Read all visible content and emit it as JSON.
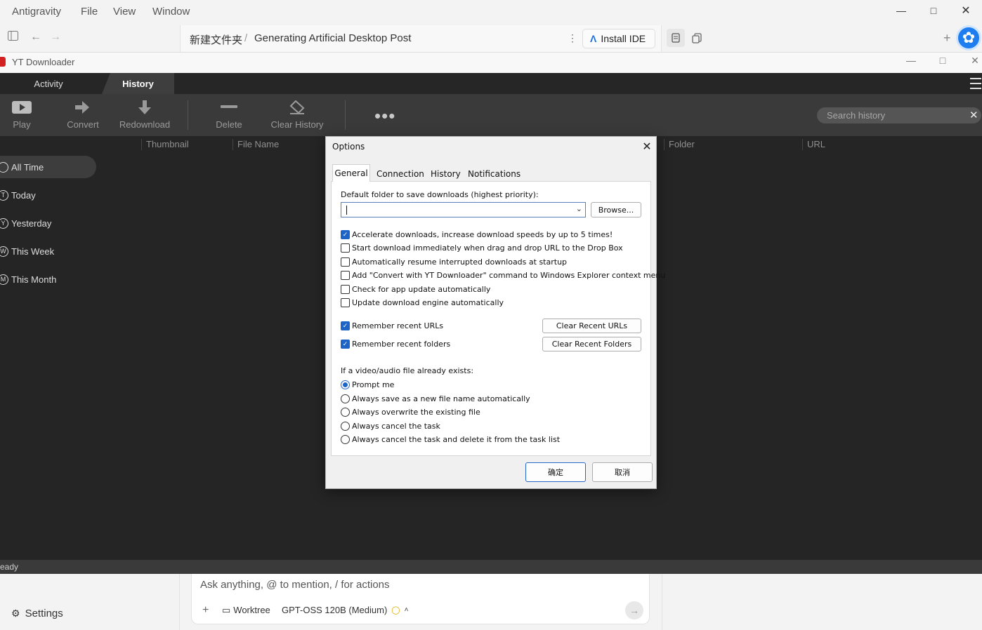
{
  "antigravity": {
    "menu": [
      "Antigravity",
      "File",
      "View",
      "Window"
    ],
    "breadcrumb": {
      "folder": "新建文件夹",
      "separator": "/",
      "page": "Generating Artificial Desktop Post"
    },
    "install_ide": "Install IDE",
    "chat": {
      "placeholder": "Ask anything, @ to mention, / for actions",
      "plus": "+",
      "worktree": "Worktree",
      "model": "GPT-OSS 120B (Medium)"
    },
    "settings": "Settings"
  },
  "yt": {
    "title": "YT Downloader",
    "tabs": [
      "Activity",
      "History"
    ],
    "active_tab": "History",
    "toolbar": [
      "Play",
      "Convert",
      "Redownload",
      "Delete",
      "Clear History"
    ],
    "search_placeholder": "Search history",
    "columns": [
      "Thumbnail",
      "File Name",
      "Folder",
      "URL"
    ],
    "sidebar": [
      {
        "letter": "",
        "label": "All Time"
      },
      {
        "letter": "T",
        "label": "Today"
      },
      {
        "letter": "Y",
        "label": "Yesterday"
      },
      {
        "letter": "W",
        "label": "This Week"
      },
      {
        "letter": "M",
        "label": "This Month"
      }
    ],
    "status": "eady"
  },
  "dialog": {
    "title": "Options",
    "tabs": [
      "General",
      "Connection",
      "History",
      "Notifications"
    ],
    "active_tab": "General",
    "folder_label": "Default folder to save downloads (highest priority):",
    "folder_value": "",
    "browse": "Browse...",
    "checkboxes": [
      {
        "label": "Accelerate downloads, increase download speeds by up to 5 times!",
        "checked": true
      },
      {
        "label": "Start download immediately when drag and drop URL to the Drop Box",
        "checked": false
      },
      {
        "label": "Automatically resume interrupted downloads at startup",
        "checked": false
      },
      {
        "label": "Add \"Convert with YT Downloader\" command to Windows Explorer context menu",
        "checked": false
      },
      {
        "label": "Check for app update automatically",
        "checked": false
      },
      {
        "label": "Update download engine automatically",
        "checked": false
      }
    ],
    "remember": [
      {
        "label": "Remember recent URLs",
        "checked": true,
        "button": "Clear Recent URLs"
      },
      {
        "label": "Remember recent folders",
        "checked": true,
        "button": "Clear Recent Folders"
      }
    ],
    "exists_label": "If a video/audio file already exists:",
    "radios": [
      {
        "label": "Prompt me",
        "selected": true
      },
      {
        "label": "Always save as a new file name automatically",
        "selected": false
      },
      {
        "label": "Always overwrite the existing file",
        "selected": false
      },
      {
        "label": "Always cancel the task",
        "selected": false
      },
      {
        "label": "Always cancel the task and delete it from the task list",
        "selected": false
      }
    ],
    "ok": "确定",
    "cancel": "取消"
  },
  "colors": {
    "accent": "#1e63c6",
    "dark_bg": "#252525",
    "toolbar_bg": "#3a3a3a"
  }
}
